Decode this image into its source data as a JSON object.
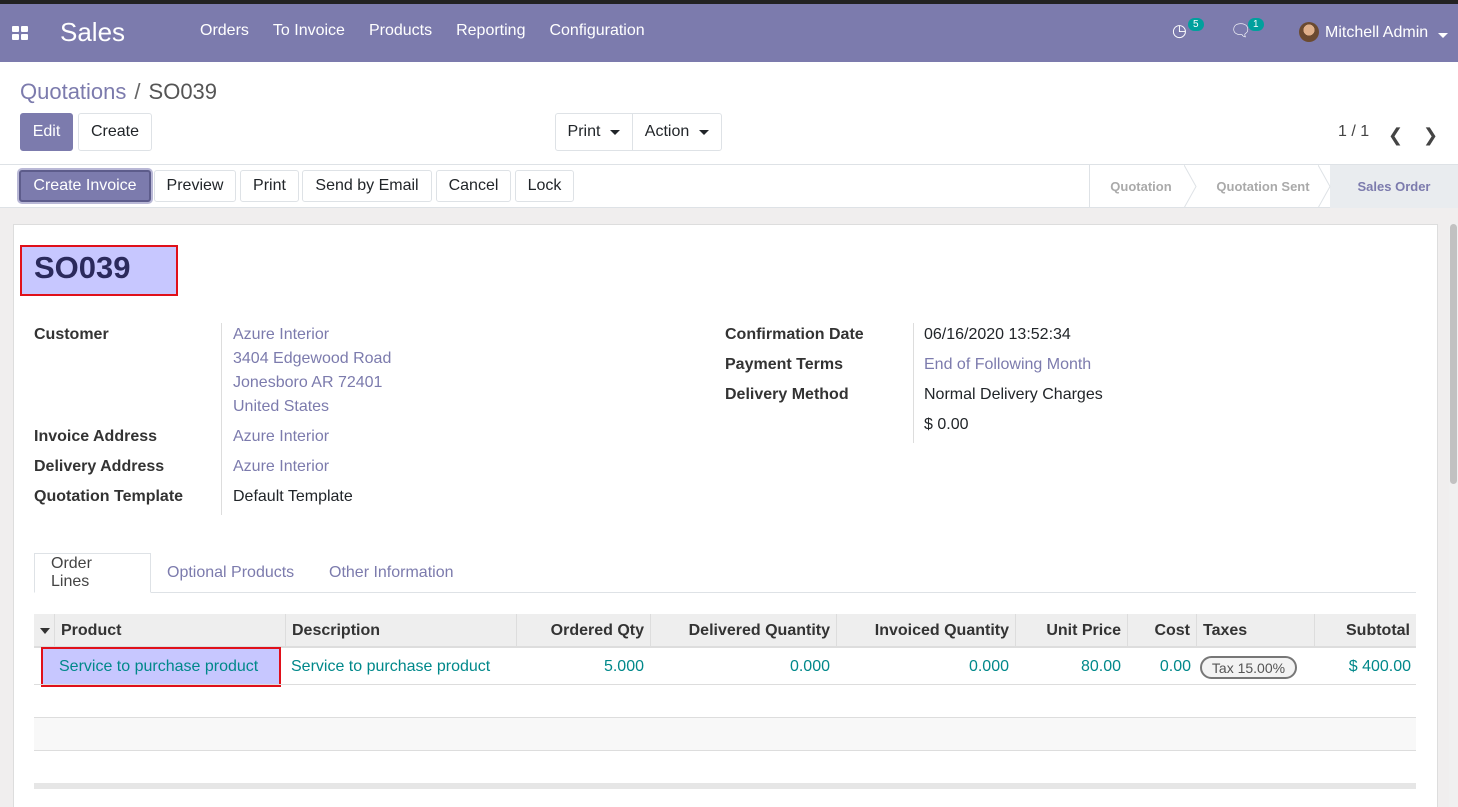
{
  "topbar": {
    "app_name": "Sales",
    "menu": [
      "Orders",
      "To Invoice",
      "Products",
      "Reporting",
      "Configuration"
    ],
    "activity_count": "5",
    "message_count": "1",
    "user_name": "Mitchell Admin"
  },
  "breadcrumb": {
    "parent": "Quotations",
    "separator": "/",
    "current": "SO039"
  },
  "control": {
    "edit": "Edit",
    "create": "Create",
    "print": "Print",
    "action": "Action",
    "pager": "1 / 1"
  },
  "statusbar": {
    "buttons": [
      "Create Invoice",
      "Preview",
      "Print",
      "Send by Email",
      "Cancel",
      "Lock"
    ],
    "stages": [
      "Quotation",
      "Quotation Sent",
      "Sales Order"
    ],
    "active_stage": "Sales Order"
  },
  "record": {
    "name": "SO039",
    "left_fields": {
      "customer_label": "Customer",
      "customer_name": "Azure Interior",
      "customer_street": "3404 Edgewood Road",
      "customer_city": "Jonesboro AR 72401",
      "customer_country": "United States",
      "invoice_label": "Invoice Address",
      "invoice_value": "Azure Interior",
      "delivery_label": "Delivery Address",
      "delivery_value": "Azure Interior",
      "template_label": "Quotation Template",
      "template_value": "Default Template"
    },
    "right_fields": {
      "confirmation_label": "Confirmation Date",
      "confirmation_value": "06/16/2020 13:52:34",
      "payment_label": "Payment Terms",
      "payment_value": "End of Following Month",
      "delivery_method_label": "Delivery Method",
      "delivery_method_value": "Normal Delivery Charges",
      "delivery_amount": "$ 0.00"
    }
  },
  "tabs": [
    "Order Lines",
    "Optional Products",
    "Other Information"
  ],
  "order_lines": {
    "columns": [
      "Product",
      "Description",
      "Ordered Qty",
      "Delivered Quantity",
      "Invoiced Quantity",
      "Unit Price",
      "Cost",
      "Taxes",
      "Subtotal"
    ],
    "rows": [
      {
        "product": "Service to purchase product",
        "description": "Service to purchase product",
        "ordered_qty": "5.000",
        "delivered_qty": "0.000",
        "invoiced_qty": "0.000",
        "unit_price": "80.00",
        "cost": "0.00",
        "taxes": "Tax 15.00%",
        "subtotal": "$ 400.00"
      }
    ]
  },
  "colors": {
    "brand": "#7c7bad",
    "highlight_box": "#c7c7ff",
    "highlight_border": "#e0101a",
    "link_teal": "#00888a"
  }
}
